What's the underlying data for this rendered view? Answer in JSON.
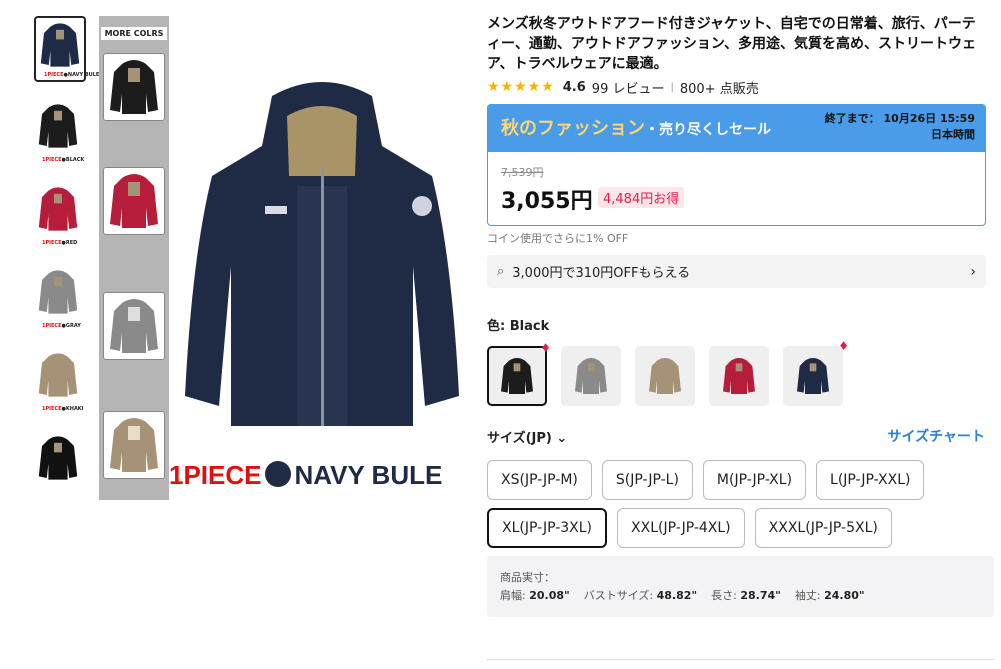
{
  "thumbnails": [
    {
      "caption_one": "1PIECE",
      "caption_color": "NAVY BULE",
      "color": "#1f2a44"
    },
    {
      "caption_one": "1PIECE",
      "caption_color": "BLACK",
      "color": "#1c1c1c"
    },
    {
      "caption_one": "1PIECE",
      "caption_color": "RED",
      "color": "#b51d3b"
    },
    {
      "caption_one": "1PIECE",
      "caption_color": "GRAY",
      "color": "#8a8a8a"
    },
    {
      "caption_one": "1PIECE",
      "caption_color": "KHAKI",
      "color": "#a69276"
    },
    {
      "caption_one": "",
      "caption_color": "",
      "color": "#111111"
    }
  ],
  "main_image": {
    "strip_title": "MORE COLRS",
    "caption_one": "1PIECE",
    "caption_color": "NAVY BULE"
  },
  "product": {
    "title": "メンズ秋冬アウトドアフード付きジャケット、自宅での日常着、旅行、パーティー、通勤、アウトドアファッション、多用途、気質を高め、ストリートウェア、トラベルウェアに最適。",
    "rating": "4.6",
    "reviews": "99 レビュー",
    "sold": "800+ 点販売"
  },
  "sale": {
    "name": "秋のファッション",
    "sub": "・売り尽くしセール",
    "ends_label": "終了まで：",
    "ends_date": "10月26日 15:59",
    "ends_tz": "日本時間",
    "old_price": "7,539円",
    "price": "3,055円",
    "save": "4,484円お得"
  },
  "coin_text": "コイン使用でさらに1% OFF",
  "coupon_text": "3,000円で310円OFFもらえる",
  "color": {
    "label_prefix": "色: ",
    "selected": "Black",
    "swatches": [
      {
        "color": "#1c1c1c",
        "hot": true,
        "selected": true
      },
      {
        "color": "#8a8a8a",
        "hot": false,
        "selected": false
      },
      {
        "color": "#a69276",
        "hot": false,
        "selected": false
      },
      {
        "color": "#b51d3b",
        "hot": false,
        "selected": false
      },
      {
        "color": "#1f2a44",
        "hot": true,
        "selected": false
      }
    ]
  },
  "size": {
    "label": "サイズ(JP)",
    "chart_link": "サイズチャート",
    "options": [
      "XS(JP-JP-M)",
      "S(JP-JP-L)",
      "M(JP-JP-XL)",
      "L(JP-JP-XXL)",
      "XL(JP-JP-3XL)",
      "XXL(JP-JP-4XL)",
      "XXXL(JP-JP-5XL)"
    ],
    "selected_index": 4
  },
  "measurements": {
    "title": "商品実寸：",
    "items": [
      {
        "label": "肩幅: ",
        "value": "20.08\""
      },
      {
        "label": "バストサイズ: ",
        "value": "48.82\""
      },
      {
        "label": "長さ: ",
        "value": "28.74\""
      },
      {
        "label": "袖丈: ",
        "value": "24.80\""
      }
    ]
  },
  "colors": {
    "accent": "#4a9be8",
    "sale_name": "#ffd66b",
    "save": "#e0204a",
    "link": "#2e7fd9"
  }
}
